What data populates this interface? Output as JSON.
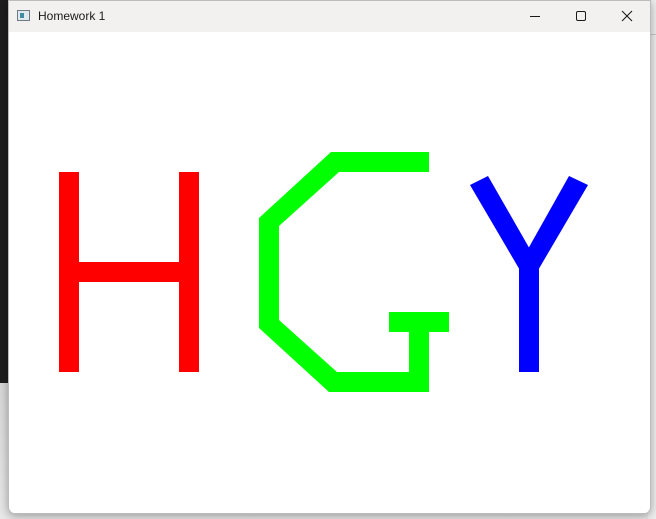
{
  "window": {
    "title": "Homework 1",
    "icon": "app-window-icon"
  },
  "controls": {
    "minimize_icon": "minimize-icon",
    "maximize_icon": "maximize-icon",
    "close_icon": "close-icon"
  },
  "canvas": {
    "background": "#ffffff",
    "letters": [
      {
        "char": "H",
        "color": "#ff0000"
      },
      {
        "char": "G",
        "color": "#00ff00"
      },
      {
        "char": "Y",
        "color": "#0000ff"
      }
    ]
  }
}
